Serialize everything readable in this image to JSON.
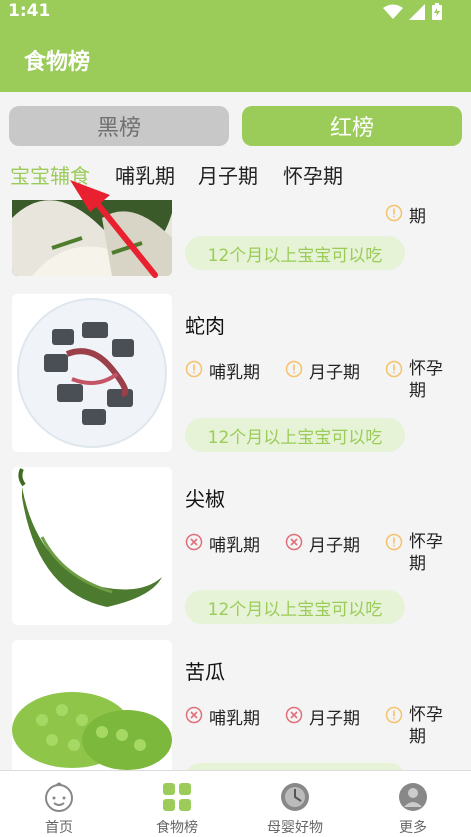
{
  "status": {
    "time": "1:41"
  },
  "header": {
    "title": "食物榜"
  },
  "segments": {
    "black": "黑榜",
    "red": "红榜"
  },
  "tabs": [
    "宝宝辅食",
    "哺乳期",
    "月子期",
    "怀孕期"
  ],
  "foods": [
    {
      "name": "",
      "image": "white-noodle-food",
      "status": [
        "caution",
        "caution",
        "caution"
      ],
      "pill": "12个月以上宝宝可以吃"
    },
    {
      "name": "蛇肉",
      "image": "snake-meat-plate",
      "status": [
        "caution",
        "caution",
        "caution"
      ],
      "pill": "12个月以上宝宝可以吃"
    },
    {
      "name": "尖椒",
      "image": "green-chili-pepper",
      "status": [
        "forbidden",
        "forbidden",
        "caution"
      ],
      "pill": "12个月以上宝宝可以吃"
    },
    {
      "name": "苦瓜",
      "image": "bitter-melon",
      "status": [
        "forbidden",
        "forbidden",
        "caution"
      ],
      "pill": ""
    }
  ],
  "labels": {
    "nursing": "哺乳期",
    "confinement": "月子期",
    "pregnancy_a": "怀孕",
    "pregnancy_b": "期",
    "cut_pregnancy_b": "期"
  },
  "nav": [
    "首页",
    "食物榜",
    "母婴好物",
    "更多"
  ],
  "colors": {
    "accent": "#9bcc5a",
    "caution": "#f5c26b",
    "forbidden": "#e0707a",
    "pill_bg": "#e6f3d6",
    "arrow": "#e8202f"
  }
}
